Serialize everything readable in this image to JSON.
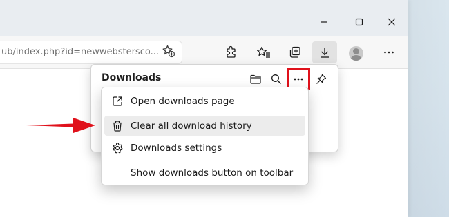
{
  "browser": {
    "address_text": "ub/index.php?id=newwebstersco...",
    "window_controls": {
      "minimize_icon": "minimize-icon",
      "maximize_icon": "maximize-icon",
      "close_icon": "close-icon"
    },
    "toolbar_icons": [
      "add-favorite-icon",
      "extensions-icon",
      "favorites-icon",
      "collections-icon",
      "downloads-icon",
      "profile-avatar",
      "settings-more-icon"
    ]
  },
  "downloads_panel": {
    "title": "Downloads",
    "icons": [
      "folder-icon",
      "search-icon",
      "more-options-icon",
      "pin-icon"
    ]
  },
  "menu": {
    "items": [
      {
        "label": "Open downloads page",
        "icon": "open-external-icon"
      },
      {
        "label": "Clear all download history",
        "icon": "trash-icon"
      },
      {
        "label": "Downloads settings",
        "icon": "gear-icon"
      },
      {
        "label": "Show downloads button on toolbar",
        "icon": ""
      }
    ]
  },
  "colors": {
    "highlight_red": "#e0111b",
    "arrow_red": "#e0111b",
    "menu_hover": "#ececec",
    "titlebar": "#e9edf1"
  }
}
